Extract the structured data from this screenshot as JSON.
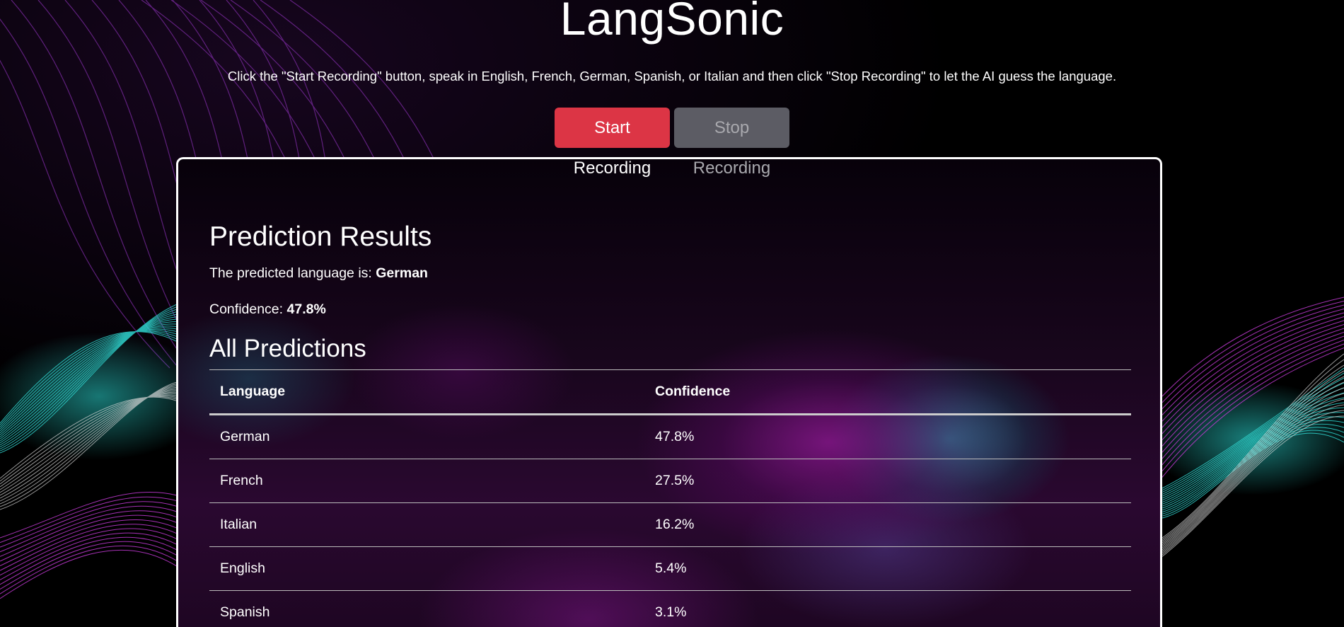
{
  "app": {
    "title": "LangSonic",
    "instructions": "Click the \"Start Recording\" button, speak in English, French, German, Spanish, or Italian and then click \"Stop Recording\" to let the AI guess the language."
  },
  "controls": {
    "start_label": "Start Recording",
    "stop_label": "Stop Recording",
    "start_color": "#dc3545",
    "stop_color": "#5c5c64"
  },
  "results": {
    "heading": "Prediction Results",
    "predicted_prefix": "The predicted language is: ",
    "predicted_language": "German",
    "confidence_prefix": "Confidence: ",
    "confidence_value": "47.8%",
    "all_heading": "All Predictions",
    "table": {
      "headers": [
        "Language",
        "Confidence"
      ],
      "rows": [
        [
          "German",
          "47.8%"
        ],
        [
          "French",
          "27.5%"
        ],
        [
          "Italian",
          "16.2%"
        ],
        [
          "English",
          "5.4%"
        ],
        [
          "Spanish",
          "3.1%"
        ]
      ]
    }
  }
}
